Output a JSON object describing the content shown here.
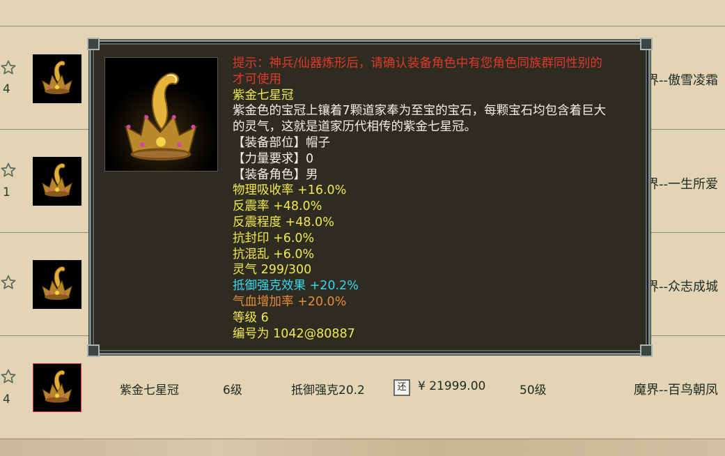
{
  "rows": [
    {
      "fav_count": "4",
      "name": "",
      "level": "",
      "attr": "",
      "price": "",
      "req_level": "",
      "seller": "界--傲雪凌霜"
    },
    {
      "fav_count": "1",
      "name": "",
      "level": "",
      "attr": "",
      "price": "",
      "req_level": "",
      "seller": "界--一生所爱"
    },
    {
      "fav_count": "",
      "name": "",
      "level": "",
      "attr": "",
      "price": "",
      "req_level": "",
      "seller": "界--众志成城"
    },
    {
      "fav_count": "4",
      "name": "紫金七星冠",
      "level": "6级",
      "attr": "抵御强克20.2",
      "price": "¥ 21999.00",
      "req_level": "50级",
      "seller": "魔界--百鸟朝凤"
    }
  ],
  "price_icon_label": "还",
  "tooltip": {
    "notice": "提示：神兵/仙器炼形后，请确认装备角色中有您角色同族群同性别的才可使用",
    "item_name": "紫金七星冠",
    "description": "紫金色的宝冠上镶着7颗道家奉为至宝的宝石，每颗宝石均包含着巨大的灵气，这就是道家历代相传的紫金七星冠。",
    "slot": "【装备部位】帽子",
    "strength_req": "【力量要求】0",
    "role": "【装备角色】男",
    "stats": [
      "物理吸收率 +16.0%",
      "反震率 +48.0%",
      "反震程度 +48.0%",
      "抗封印 +6.0%",
      "抗混乱 +6.0%",
      "灵气 299/300"
    ],
    "special_stat": "抵御强克效果 +20.2%",
    "special_stat_parts": [
      "抵御强克效果",
      " +20.2%"
    ],
    "hp_stat_parts": [
      "气血增加率",
      " +20.0%"
    ],
    "grade": "等级 6",
    "serial": "编号为 1042@80887"
  },
  "colors": {
    "notice": "#e0382c",
    "stat": "#f1ea4f",
    "special": "#33d8f0",
    "hp": "#e88b3a",
    "selected_border": "#e23030"
  }
}
